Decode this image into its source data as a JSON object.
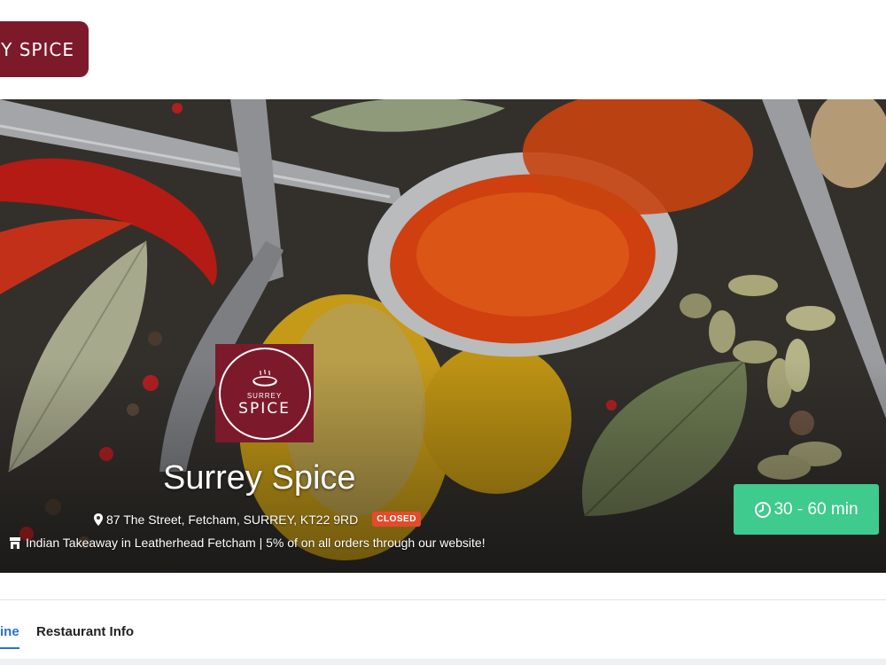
{
  "header": {
    "logo_text": "Y SPICE"
  },
  "hero": {
    "emblem": {
      "top_text": "SURREY",
      "bottom_text": "SPICE"
    },
    "restaurant_name": "Surrey Spice",
    "address": "87 The Street, Fetcham, SURREY, KT22 9RD",
    "status_badge": "CLOSED",
    "description": "Indian Takeaway in Leatherhead Fetcham | 5% of on all orders through our website!",
    "delivery_time": "30 - 60 min"
  },
  "tabs": [
    {
      "label": "ine"
    },
    {
      "label": "Restaurant Info"
    }
  ],
  "colors": {
    "brand": "#7c1a2c",
    "accent_green": "#3ecb8d",
    "badge_red": "#e34b2a",
    "tab_active": "#2a6fd8"
  }
}
